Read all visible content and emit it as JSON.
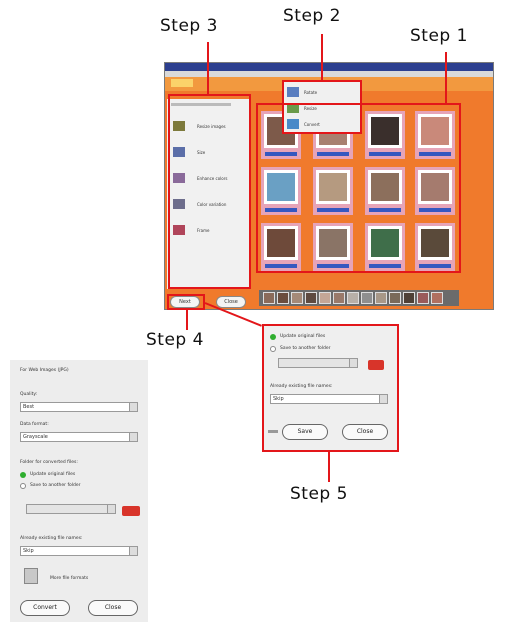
{
  "steps": {
    "step1": "Step 1",
    "step2": "Step 2",
    "step3": "Step 3",
    "step4": "Step 4",
    "step5": "Step 5"
  },
  "main_window": {
    "sidebar_items": [
      "Resize images",
      "Size",
      "Enhance colors",
      "Color variation",
      "Frame"
    ],
    "dropdown_items": [
      "Rotate",
      "Resize",
      "Convert"
    ],
    "next_button": "Next",
    "close_button": "Close"
  },
  "step5_panel": {
    "option_update": "Update original files",
    "option_save": "Save to another folder",
    "existing_label": "Already existing file names:",
    "existing_value": "Skip",
    "save_button": "Save",
    "close_button": "Close"
  },
  "left_panel": {
    "heading": "For Web Images (JPG)",
    "quality_label": "Quality:",
    "quality_value": "Best",
    "format_label": "Data format:",
    "format_value": "Grayscale",
    "folder_label": "Folder for converted files:",
    "option_update": "Update original files",
    "option_save": "Save to another folder",
    "existing_label": "Already existing file names:",
    "existing_value": "Skip",
    "more_formats": "More file formats",
    "convert_button": "Convert",
    "close_button": "Close"
  },
  "colors": {
    "annotation": "#e3161a",
    "accent": "#f07a2c"
  }
}
